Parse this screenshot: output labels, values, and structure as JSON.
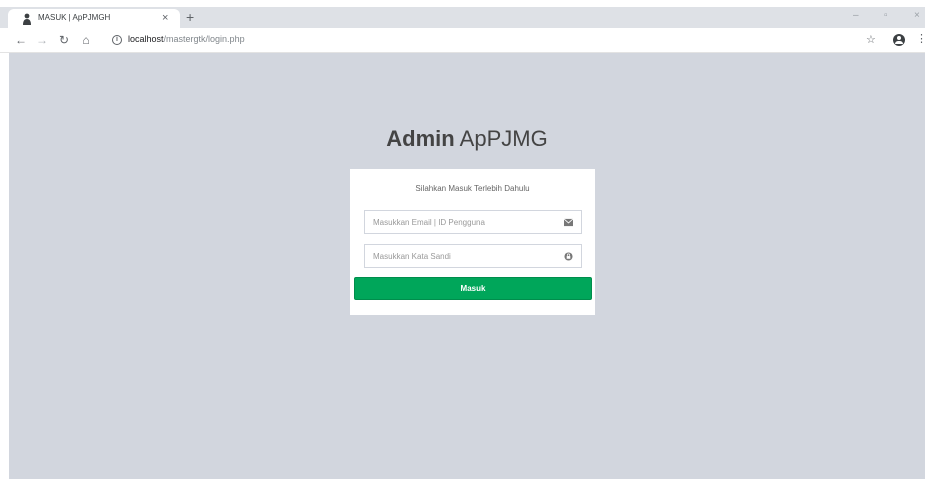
{
  "browser": {
    "tab_title": "MASUK | ApPJMGH",
    "new_tab_label": "+",
    "tab_close_label": "×",
    "url_host": "localhost",
    "url_path": "/mastergtk/login.php",
    "window_controls": {
      "minimize": "–",
      "restore": "▫",
      "close": "×"
    }
  },
  "icons": {
    "favicon": "user-icon",
    "email": "envelope-icon",
    "password": "lock-icon"
  },
  "page": {
    "logo_bold": "Admin",
    "logo_light": "ApPJMG",
    "login_message": "Silahkan Masuk Terlebih Dahulu",
    "email_placeholder": "Masukkan Email | ID Pengguna",
    "password_placeholder": "Masukkan Kata Sandi",
    "submit_label": "Masuk"
  },
  "colors": {
    "background": "#d2d6de",
    "button": "#00a65a",
    "box": "#ffffff"
  }
}
